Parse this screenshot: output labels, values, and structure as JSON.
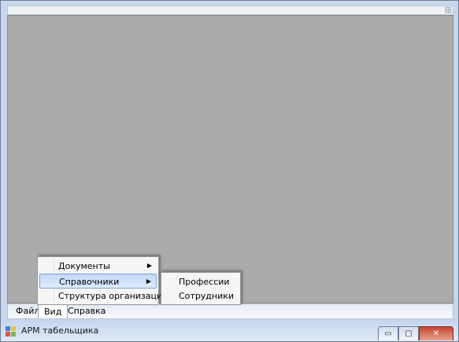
{
  "window": {
    "title": "АРМ табельщика",
    "buttons": {
      "minimize": "▭",
      "maximize": "▢",
      "close": "✕"
    }
  },
  "menubar": {
    "items": [
      {
        "label": "Файл"
      },
      {
        "label": "Вид",
        "open": true
      },
      {
        "label": "Справка"
      }
    ]
  },
  "dropdown": {
    "items": [
      {
        "label": "Структура организации",
        "has_submenu": false
      },
      {
        "label": "Справочники",
        "has_submenu": true,
        "highlighted": true
      },
      {
        "label": "Документы",
        "has_submenu": true
      }
    ]
  },
  "submenu": {
    "items": [
      {
        "label": "Сотрудники"
      },
      {
        "label": "Профессии"
      }
    ]
  },
  "colors": {
    "client_area": "#ababab",
    "highlight": "#c1dbfc",
    "titlebar": "#c3d5ee",
    "close_button": "#c8452b"
  },
  "icons": {
    "app": "app-icon",
    "submenu_arrow": "submenu-arrow-icon"
  }
}
